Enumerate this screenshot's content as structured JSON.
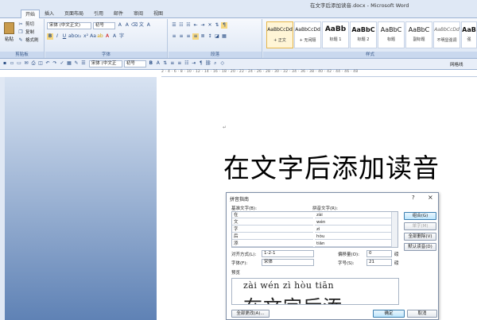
{
  "window": {
    "title": "在文字后添加读音.docx - Microsoft Word"
  },
  "tabs": [
    "开始",
    "插入",
    "页面布局",
    "引用",
    "邮件",
    "审阅",
    "视图"
  ],
  "ribbon": {
    "clipboard": {
      "paste": "粘贴",
      "cut": "剪切",
      "copy": "复制",
      "format_painter": "格式刷",
      "label": "剪贴板"
    },
    "font": {
      "name": "宋体 (中文正文)",
      "size": "初号",
      "label": "字体"
    },
    "paragraph": {
      "label": "段落"
    },
    "styles": {
      "label": "样式",
      "items": [
        {
          "preview": "AaBbCcDd",
          "name": "+ 正文"
        },
        {
          "preview": "AaBbCcDd",
          "name": "+ 无间隔"
        },
        {
          "preview": "AaBb",
          "name": "标题 1"
        },
        {
          "preview": "AaBbC",
          "name": "标题 2"
        },
        {
          "preview": "AaBbC",
          "name": "标题"
        },
        {
          "preview": "AaBbC",
          "name": "副标题"
        },
        {
          "preview": "AaBbCcDd",
          "name": "不明显强调"
        },
        {
          "preview": "AaB",
          "name": "强"
        }
      ]
    }
  },
  "qat": {
    "font": "宋体 (中文正",
    "size": "初号",
    "right_label": "网格线"
  },
  "ruler": {
    "ticks": "2 · 4 · 6 · 8 · 10 · 12 · 14 · 16 · 18 · 20 · 22 · 24 · 26 · 28 · 30 · 32 · 34 · 36 · 38 · 40 · 42 · 44 · 46 · 48"
  },
  "document": {
    "text": "在文字后添加读音"
  },
  "dialog": {
    "title": "拼音指南",
    "help": "?",
    "close": "×",
    "base_label": "基准文字(B):",
    "ruby_label": "拼音文字(R):",
    "rows": [
      {
        "base": "在",
        "ruby": "zài"
      },
      {
        "base": "文",
        "ruby": "wén"
      },
      {
        "base": "字",
        "ruby": "zì"
      },
      {
        "base": "后",
        "ruby": "hòu"
      },
      {
        "base": "添",
        "ruby": "tiān"
      }
    ],
    "buttons": {
      "group": "组合(G)",
      "single": "单字(M)",
      "clear": "全部删除(V)",
      "default": "默认读音(D)",
      "change_all": "全部更改(A)...",
      "ok": "确定",
      "cancel": "取消"
    },
    "alignment_label": "对齐方式(L):",
    "alignment_value": "1-2-1",
    "offset_label": "偏移量(O):",
    "offset_value": "0",
    "offset_unit": "磅",
    "font_label": "字体(F):",
    "font_value": "宋体",
    "size_label": "字号(S):",
    "size_value": "21",
    "size_unit": "磅",
    "preview_label": "预览",
    "preview_pinyin": "zài wén zì hòu tiān",
    "preview_text": "在文字后添"
  }
}
